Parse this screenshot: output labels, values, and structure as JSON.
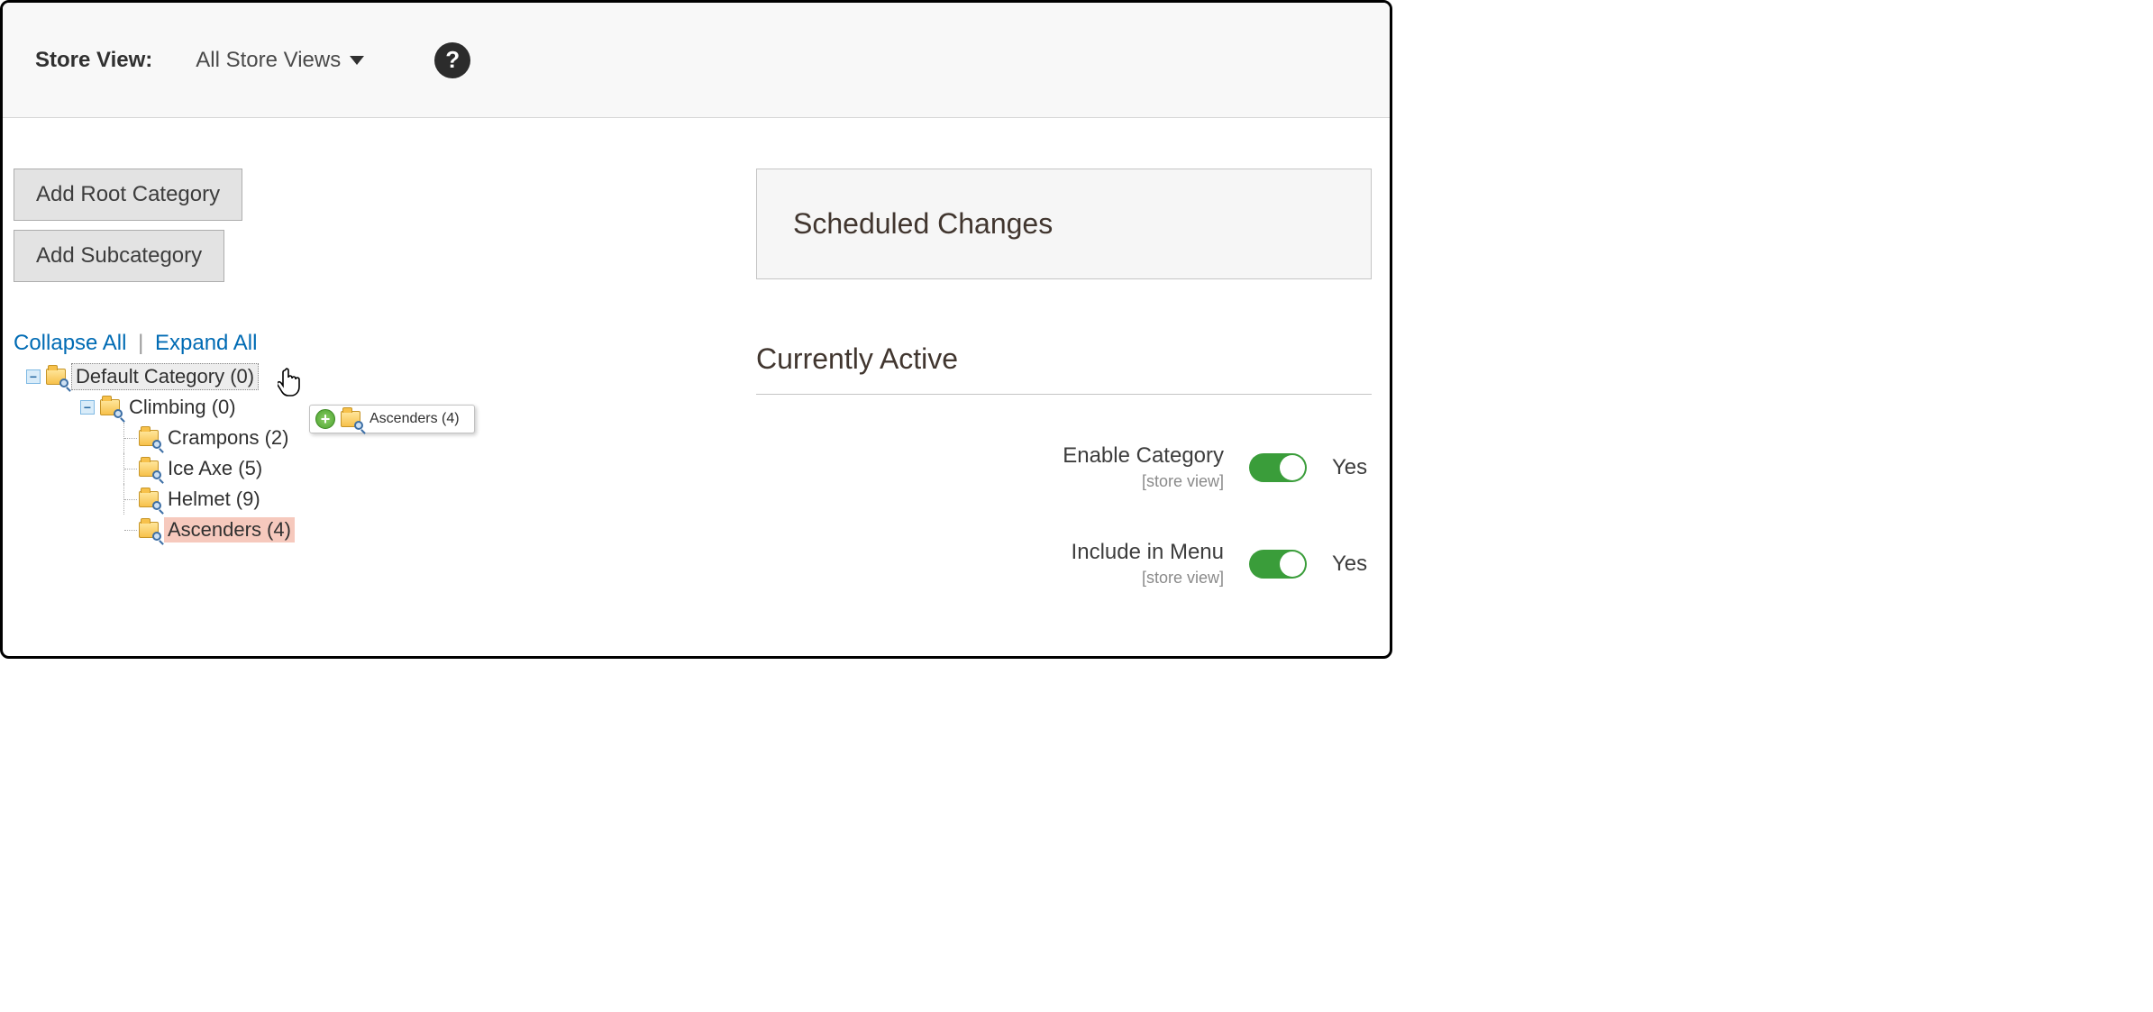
{
  "topbar": {
    "store_view_label": "Store View:",
    "store_view_value": "All Store Views",
    "help_icon_glyph": "?"
  },
  "left": {
    "add_root_label": "Add Root Category",
    "add_sub_label": "Add Subcategory",
    "collapse_label": "Collapse All",
    "expand_label": "Expand All",
    "tree": {
      "root": {
        "label": "Default Category (0)"
      },
      "climbing": {
        "label": "Climbing (0)"
      },
      "crampons": {
        "label": "Crampons (2)"
      },
      "iceaxe": {
        "label": "Ice Axe (5)"
      },
      "helmet": {
        "label": "Helmet (9)"
      },
      "ascenders": {
        "label": "Ascenders (4)"
      }
    },
    "drag_ghost_label": "Ascenders (4)"
  },
  "right": {
    "scheduled_title": "Scheduled Changes",
    "active_title": "Currently Active",
    "enable_category_label": "Enable Category",
    "include_in_menu_label": "Include in Menu",
    "scope_label": "[store view]",
    "yes_label": "Yes"
  }
}
